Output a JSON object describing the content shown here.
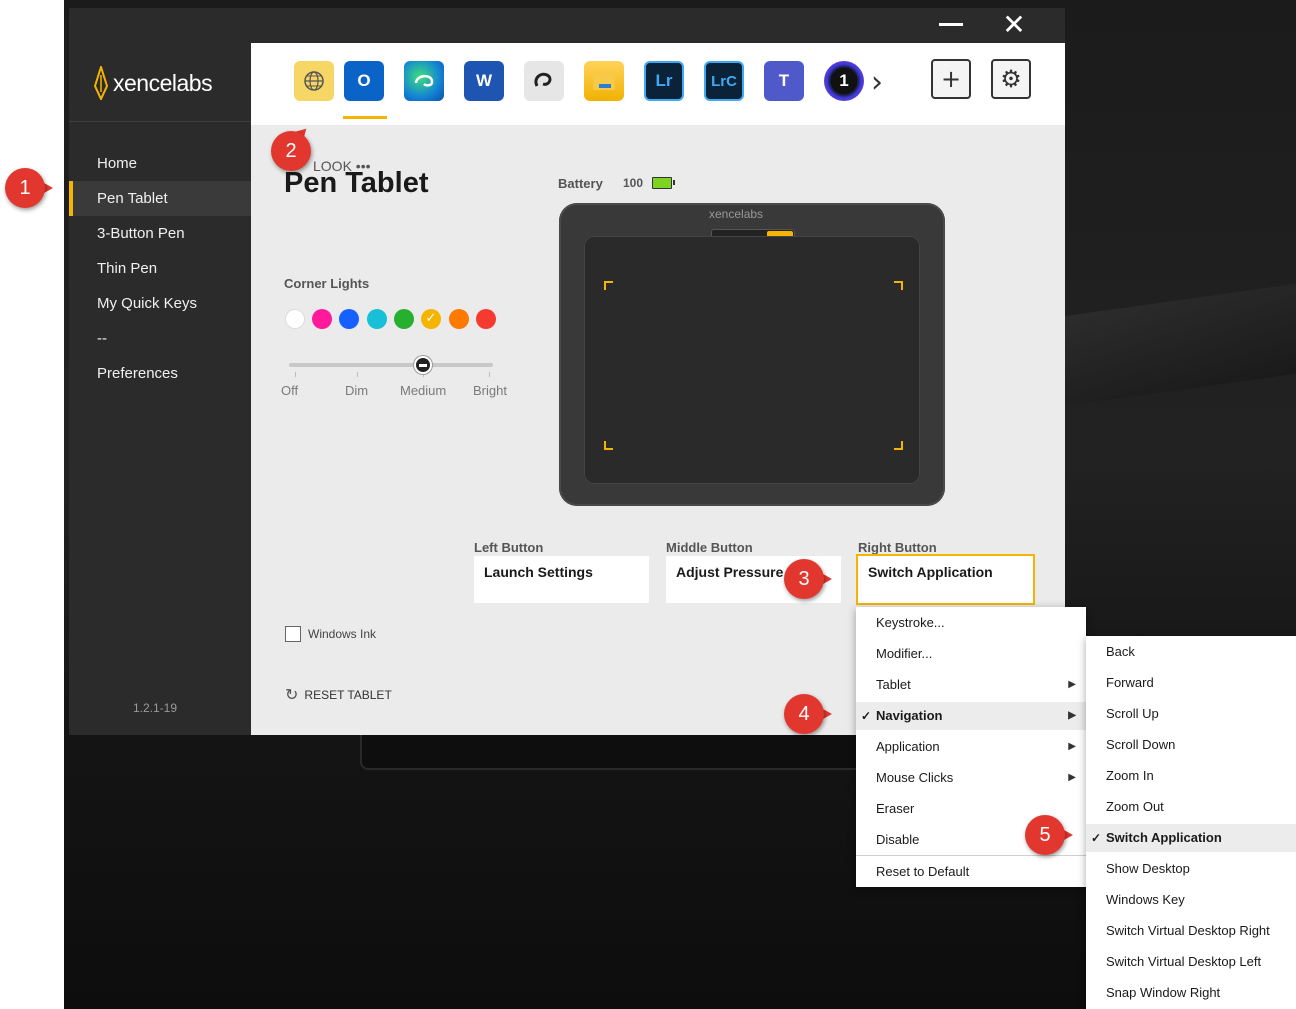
{
  "window": {
    "minimize_icon": "minimize-icon",
    "close_label": "✕"
  },
  "brand": {
    "name": "xencelabs",
    "accent_color": "#f4b400"
  },
  "sidebar": {
    "items": [
      {
        "label": "Home"
      },
      {
        "label": "Pen Tablet"
      },
      {
        "label": "3-Button Pen"
      },
      {
        "label": "Thin Pen"
      },
      {
        "label": "My Quick Keys"
      },
      {
        "label": "--"
      },
      {
        "label": "Preferences"
      }
    ],
    "active_index": 1,
    "version": "1.2.1-19"
  },
  "apps": {
    "icons": [
      "globe-icon",
      "outlook-icon",
      "edge-icon",
      "word-icon",
      "clip-studio-icon",
      "file-explorer-icon",
      "lightroom-icon",
      "lightroom-classic-icon",
      "teams-icon",
      "app-one-icon"
    ],
    "selected": "outlook-icon",
    "lr_label": "Lr",
    "lrc_label": "LrC",
    "w_label": "W",
    "o_label": "O",
    "t_label": "T",
    "one_label": "1",
    "more_label": "›",
    "add_label": "+",
    "settings_label": "⚙"
  },
  "main": {
    "look_label": "LOOK •••",
    "title": "Pen Tablet",
    "battery_label": "Battery",
    "battery_value": "100",
    "tablet_brand": "xencelabs",
    "corner_lights_label": "Corner Lights",
    "colors": [
      "#ffffff",
      "#ff1a9c",
      "#1560ff",
      "#17c0d6",
      "#27b030",
      "#f4b400",
      "#ff7a00",
      "#f53b30"
    ],
    "selected_color_index": 5,
    "brightness_levels": [
      "Off",
      "Dim",
      "Medium",
      "Bright"
    ],
    "brightness_selected": "Medium",
    "left_button_label": "Left Button",
    "left_button_value": "Launch Settings",
    "middle_button_label": "Middle Button",
    "middle_button_value": "Adjust Pressure",
    "right_button_label": "Right Button",
    "right_button_value": "Switch Application",
    "windows_ink_label": "Windows Ink",
    "windows_ink_checked": false,
    "reset_label": "RESET TABLET"
  },
  "menu": {
    "items": [
      {
        "label": "Keystroke..."
      },
      {
        "label": "Modifier..."
      },
      {
        "label": "Tablet"
      },
      {
        "label": "Navigation"
      },
      {
        "label": "Application"
      },
      {
        "label": "Mouse Clicks"
      },
      {
        "label": "Eraser"
      },
      {
        "label": "Disable"
      },
      {
        "label": "Reset to Default"
      }
    ],
    "checked": "Navigation"
  },
  "submenu": {
    "items": [
      {
        "label": "Back"
      },
      {
        "label": "Forward"
      },
      {
        "label": "Scroll Up"
      },
      {
        "label": "Scroll Down"
      },
      {
        "label": "Zoom In"
      },
      {
        "label": "Zoom Out"
      },
      {
        "label": "Switch Application"
      },
      {
        "label": "Show Desktop"
      },
      {
        "label": "Windows Key"
      },
      {
        "label": "Switch Virtual Desktop Right"
      },
      {
        "label": "Switch Virtual Desktop Left"
      },
      {
        "label": "Snap Window Right"
      }
    ],
    "checked": "Switch Application"
  },
  "callouts": [
    "1",
    "2",
    "3",
    "4",
    "5"
  ],
  "callout_color": "#e2372e"
}
